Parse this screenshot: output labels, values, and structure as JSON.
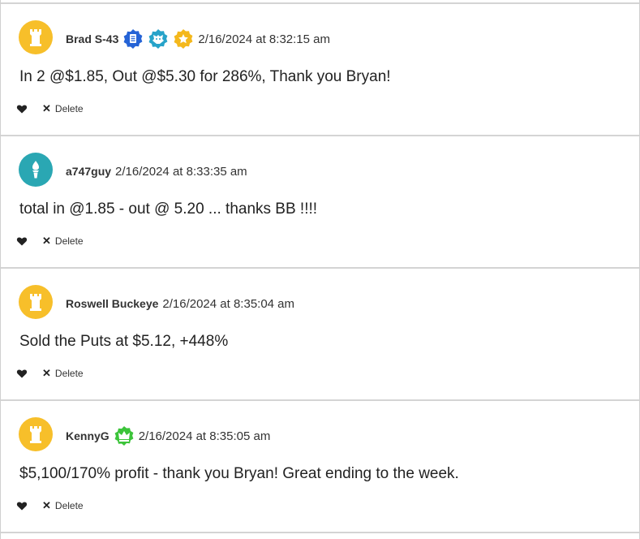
{
  "comments": [
    {
      "username": "Brad S-43",
      "avatar_color": "#f7bf2a",
      "avatar_icon": "castle-tower-icon",
      "badges": [
        {
          "name": "document-badge-icon",
          "color": "#2563d6"
        },
        {
          "name": "lion-badge-icon",
          "color": "#27a3c9"
        },
        {
          "name": "star-badge-icon",
          "color": "#f4b81c"
        }
      ],
      "timestamp": "2/16/2024 at 8:32:15 am",
      "text": "In 2 @$1.85, Out @$5.30 for 286%, Thank you Bryan!",
      "delete_label": "Delete"
    },
    {
      "username": "a747guy",
      "avatar_color": "#2aa7b3",
      "avatar_icon": "torch-icon",
      "badges": [],
      "timestamp": "2/16/2024 at 8:33:35 am",
      "text": "total in @1.85 - out @ 5.20 ... thanks BB !!!!",
      "delete_label": "Delete"
    },
    {
      "username": "Roswell Buckeye",
      "avatar_color": "#f7bf2a",
      "avatar_icon": "castle-tower-icon",
      "badges": [],
      "timestamp": "2/16/2024 at 8:35:04 am",
      "text": "Sold the Puts at $5.12, +448%",
      "delete_label": "Delete"
    },
    {
      "username": "KennyG",
      "avatar_color": "#f7bf2a",
      "avatar_icon": "castle-tower-icon",
      "badges": [
        {
          "name": "crown-badge-icon",
          "color": "#3cc43a"
        }
      ],
      "timestamp": "2/16/2024 at 8:35:05 am",
      "text": "$5,100/170% profit - thank you Bryan! Great ending to the week.",
      "delete_label": "Delete"
    }
  ]
}
